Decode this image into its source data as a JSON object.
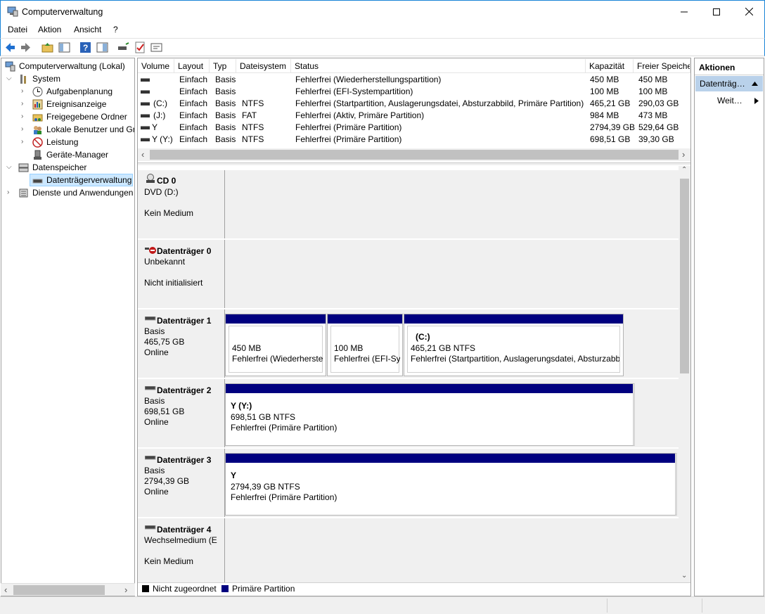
{
  "window": {
    "title": "Computerverwaltung",
    "minimize": "—",
    "maximize": "☐",
    "close": "✕"
  },
  "menu": {
    "file": "Datei",
    "action": "Aktion",
    "view": "Ansicht",
    "help": "?"
  },
  "tree": {
    "root": "Computerverwaltung (Lokal)",
    "system": "System",
    "task_scheduler": "Aufgabenplanung",
    "event_viewer": "Ereignisanzeige",
    "shared_folders": "Freigegebene Ordner",
    "local_users": "Lokale Benutzer und Gruppen",
    "performance": "Leistung",
    "device_manager": "Geräte-Manager",
    "storage": "Datenspeicher",
    "disk_management": "Datenträgerverwaltung",
    "services": "Dienste und Anwendungen"
  },
  "volume_table": {
    "headers": [
      "Volume",
      "Layout",
      "Typ",
      "Dateisystem",
      "Status",
      "Kapazität",
      "Freier Speiche"
    ],
    "rows": [
      {
        "volume": "",
        "layout": "Einfach",
        "type": "Basis",
        "fs": "",
        "status": "Fehlerfrei (Wiederherstellungspartition)",
        "capacity": "450 MB",
        "free": "450 MB"
      },
      {
        "volume": "",
        "layout": "Einfach",
        "type": "Basis",
        "fs": "",
        "status": "Fehlerfrei (EFI-Systempartition)",
        "capacity": "100 MB",
        "free": "100 MB"
      },
      {
        "volume": "(C:)",
        "layout": "Einfach",
        "type": "Basis",
        "fs": "NTFS",
        "status": "Fehlerfrei (Startpartition, Auslagerungsdatei, Absturzabbild, Primäre Partition)",
        "capacity": "465,21 GB",
        "free": "290,03 GB"
      },
      {
        "volume": "(J:)",
        "layout": "Einfach",
        "type": "Basis",
        "fs": "FAT",
        "status": "Fehlerfrei (Aktiv, Primäre Partition)",
        "capacity": "984 MB",
        "free": "473 MB"
      },
      {
        "volume": "Y",
        "layout": "Einfach",
        "type": "Basis",
        "fs": "NTFS",
        "status": "Fehlerfrei (Primäre Partition)",
        "capacity": "2794,39 GB",
        "free": "529,64 GB"
      },
      {
        "volume": "Y (Y:)",
        "layout": "Einfach",
        "type": "Basis",
        "fs": "NTFS",
        "status": "Fehlerfrei (Primäre Partition)",
        "capacity": "698,51 GB",
        "free": "39,30 GB"
      }
    ]
  },
  "disks": {
    "cd0": {
      "name": "CD 0",
      "l1": "DVD (D:)",
      "l2": "",
      "l3": "Kein Medium"
    },
    "d0": {
      "name": "Datenträger 0",
      "l1": "Unbekannt",
      "l2": "",
      "l3": "Nicht initialisiert"
    },
    "d1": {
      "name": "Datenträger 1",
      "l1": "Basis",
      "l2": "465,75 GB",
      "l3": "Online",
      "p1": {
        "l1": "450 MB",
        "l2": "Fehlerfrei (Wiederherstellungspartition)"
      },
      "p2": {
        "l1": "100 MB",
        "l2": "Fehlerfrei (EFI-Systempartition)"
      },
      "p3": {
        "title": "(C:)",
        "l1": "465,21 GB NTFS",
        "l2": "Fehlerfrei (Startpartition, Auslagerungsdatei, Absturzabbild"
      }
    },
    "d2": {
      "name": "Datenträger 2",
      "l1": "Basis",
      "l2": "698,51 GB",
      "l3": "Online",
      "p1": {
        "title": "Y  (Y:)",
        "l1": "698,51 GB NTFS",
        "l2": "Fehlerfrei (Primäre Partition)"
      }
    },
    "d3": {
      "name": "Datenträger 3",
      "l1": "Basis",
      "l2": "2794,39 GB",
      "l3": "Online",
      "p1": {
        "title": "Y",
        "l1": "2794,39 GB NTFS",
        "l2": "Fehlerfrei (Primäre Partition)"
      }
    },
    "d4": {
      "name": "Datenträger 4",
      "l1": "Wechselmedium (E:)",
      "l2": "",
      "l3": "Kein Medium"
    }
  },
  "legend": {
    "unallocated": "Nicht zugeordnet",
    "primary": "Primäre Partition"
  },
  "actions": {
    "header": "Aktionen",
    "section": "Datenträgerverwaltung",
    "more": "Weitere Aktionen"
  },
  "colors": {
    "primary_partition": "#00007f",
    "unallocated": "#000000",
    "selection": "#cce8ff",
    "window_border": "#1883d7"
  }
}
